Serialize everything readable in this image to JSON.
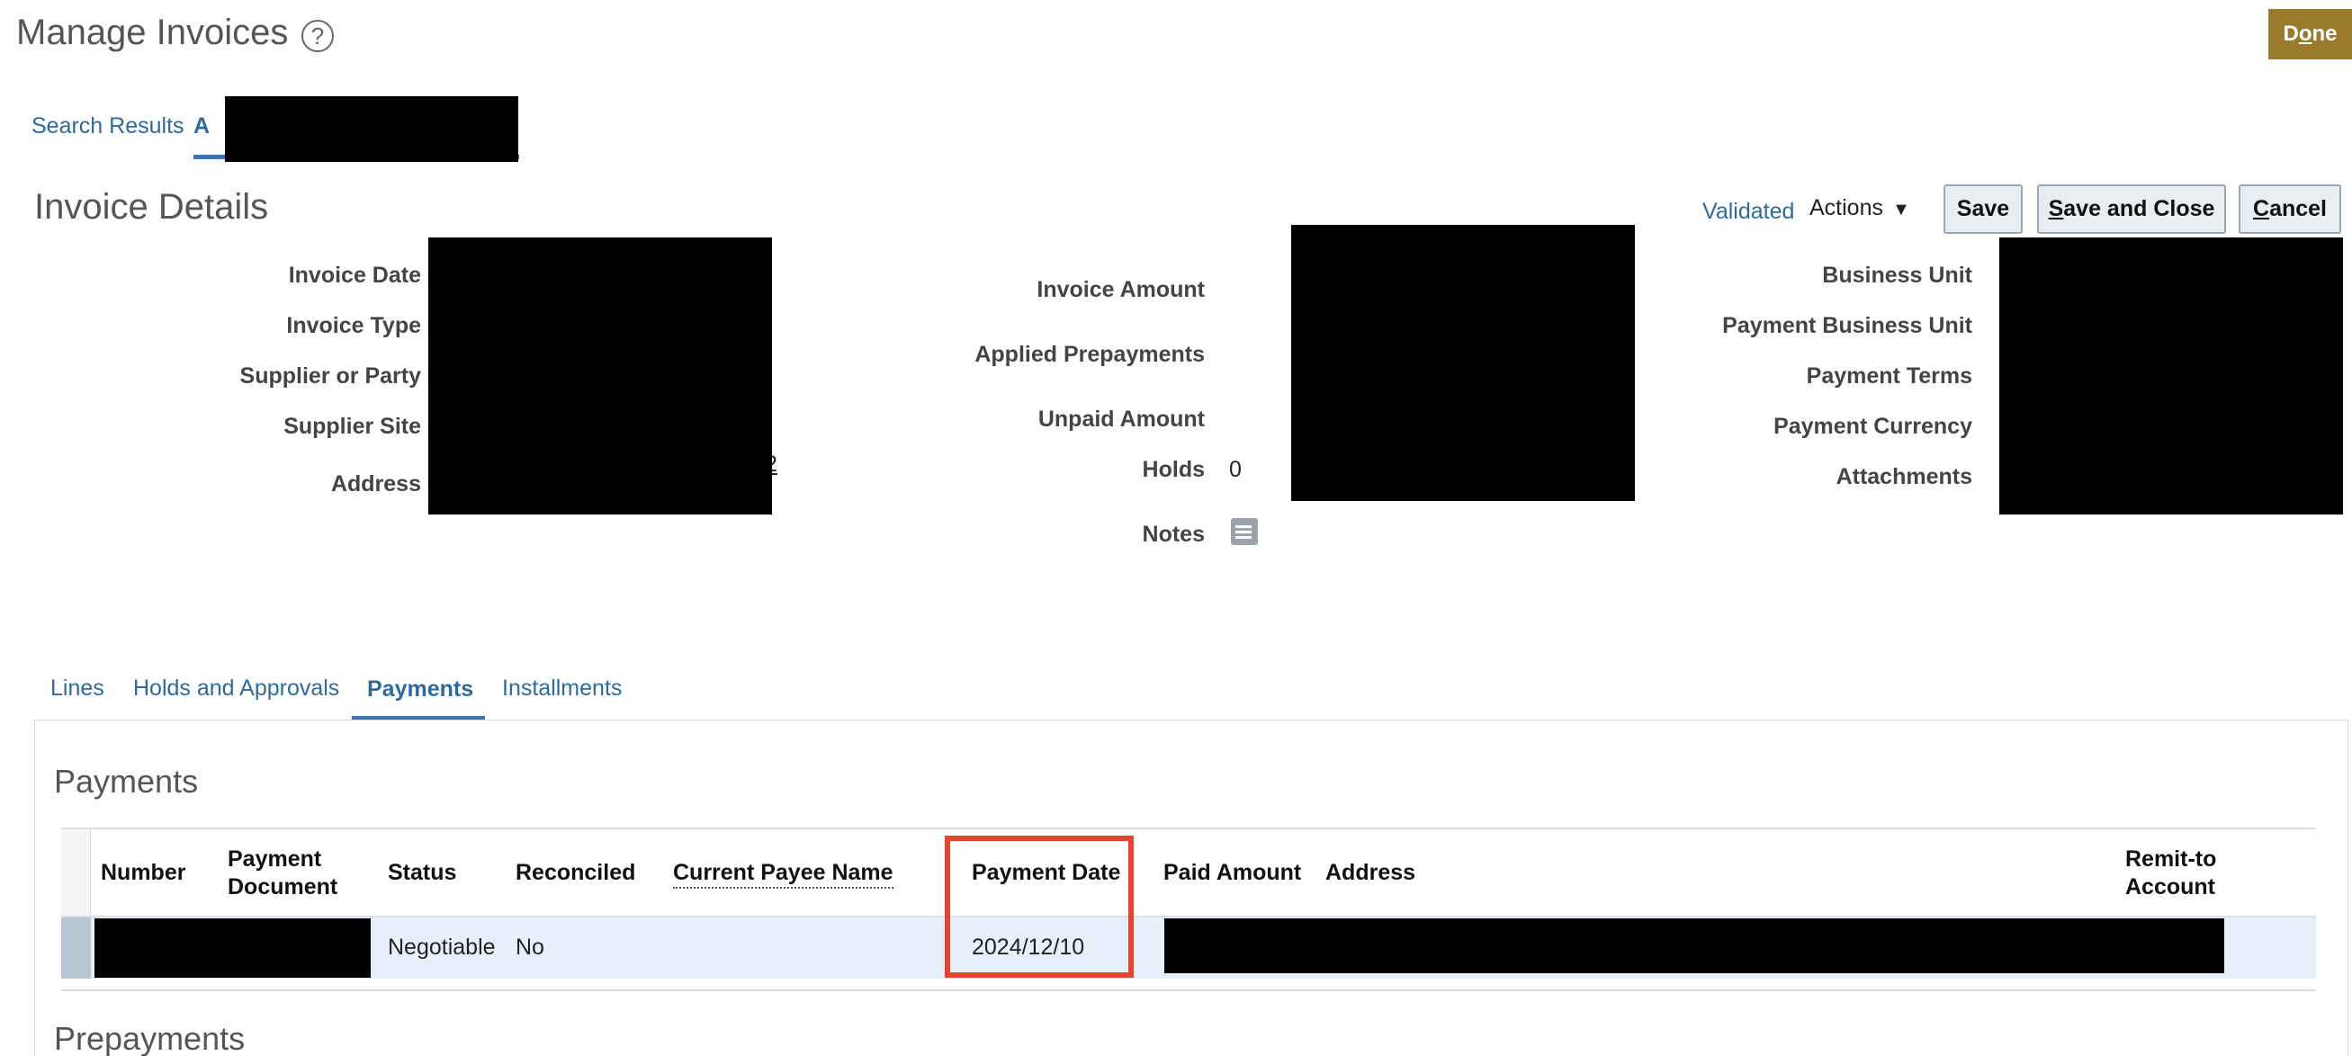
{
  "header": {
    "title": "Manage Invoices",
    "help_icon": "question-circle-icon",
    "done_label_pre": "D",
    "done_label_u": "o",
    "done_label_post": "ne"
  },
  "top_tabs": {
    "search_results": "Search Results",
    "active_tab_prefix": "A"
  },
  "invoice_details": {
    "title": "Invoice Details",
    "status": "Validated",
    "actions_label": "Actions",
    "save_label": "Save",
    "save_close_u": "S",
    "save_close_rest": "ave and Close",
    "cancel_u": "C",
    "cancel_rest": "ancel",
    "labels": {
      "invoice_date": "Invoice Date",
      "invoice_type": "Invoice Type",
      "supplier_or_party": "Supplier or Party",
      "supplier_site": "Supplier Site",
      "address": "Address",
      "invoice_amount": "Invoice Amount",
      "applied_prepayments": "Applied Prepayments",
      "unpaid_amount": "Unpaid Amount",
      "holds": "Holds",
      "notes": "Notes",
      "business_unit": "Business Unit",
      "payment_business_unit": "Payment Business Unit",
      "payment_terms": "Payment Terms",
      "payment_currency": "Payment Currency",
      "attachments": "Attachments"
    },
    "values": {
      "holds": "0",
      "address_fragment": "2"
    },
    "notes_icon": "notes-edit-icon"
  },
  "sub_tabs": {
    "lines": "Lines",
    "holds_approvals": "Holds and Approvals",
    "payments": "Payments",
    "installments": "Installments"
  },
  "payments_panel": {
    "title": "Payments",
    "columns": {
      "number": "Number",
      "payment_document_1": "Payment",
      "payment_document_2": "Document",
      "status": "Status",
      "reconciled": "Reconciled",
      "current_payee_name": "Current Payee Name",
      "payment_date": "Payment Date",
      "paid_amount": "Paid Amount",
      "address": "Address",
      "remit_to_1": "Remit-to",
      "remit_to_2": "Account"
    },
    "rows": [
      {
        "status": "Negotiable",
        "reconciled": "No",
        "payment_date": "2024/12/10"
      }
    ]
  },
  "prepayments_panel": {
    "title": "Prepayments"
  },
  "colors": {
    "accent": "#2e6a9e",
    "done_button": "#9a7b2e",
    "highlight": "#e5452e",
    "row_bg": "#e6f0fb"
  }
}
